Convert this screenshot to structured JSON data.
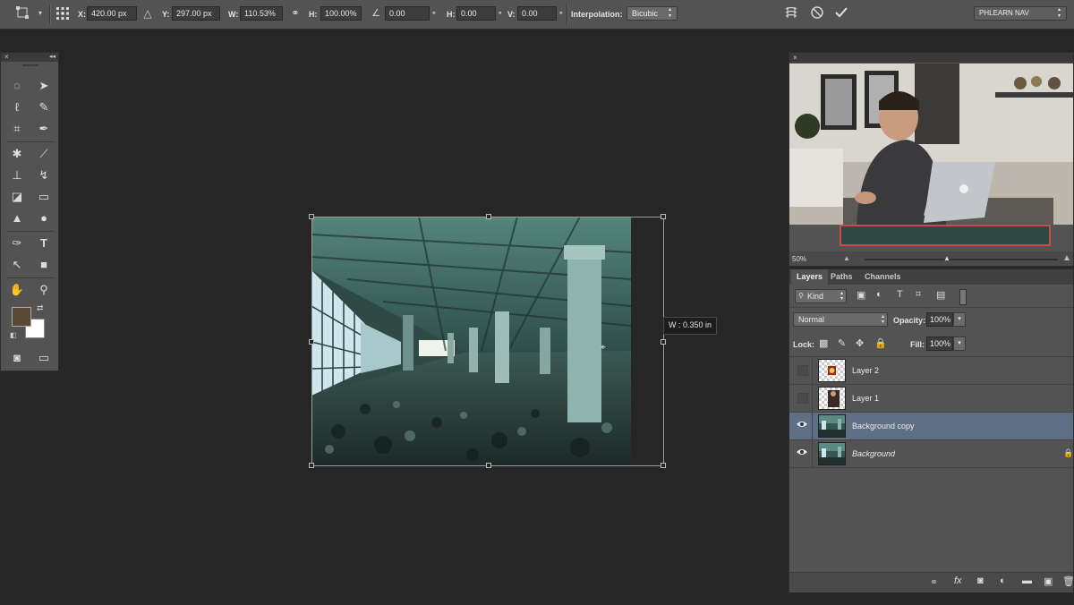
{
  "options_bar": {
    "x_label": "X:",
    "x_value": "420.00 px",
    "y_label": "Y:",
    "y_value": "297.00 px",
    "w_label": "W:",
    "w_value": "110.53%",
    "h_label": "H:",
    "h_value": "100.00%",
    "angle_value": "0.00",
    "angle_unit": "°",
    "hskew_label": "H:",
    "hskew_value": "0.00",
    "hskew_unit": "°",
    "vskew_label": "V:",
    "vskew_value": "0.00",
    "vskew_unit": "°",
    "interpolation_label": "Interpolation:",
    "interpolation_value": "Bicubic",
    "workspace_value": "PHLEARN NAV"
  },
  "canvas": {
    "tooltip": "W : 0.350 in"
  },
  "navigator": {
    "zoom": "50%"
  },
  "layers_panel": {
    "tabs": [
      "Layers",
      "Paths",
      "Channels"
    ],
    "kind_label": "Kind",
    "blend_mode": "Normal",
    "opacity_label": "Opacity:",
    "opacity_value": "100%",
    "lock_label": "Lock:",
    "fill_label": "Fill:",
    "fill_value": "100%",
    "layers": [
      {
        "name": "Layer 2",
        "visible": false,
        "selected": false
      },
      {
        "name": "Layer 1",
        "visible": false,
        "selected": false
      },
      {
        "name": "Background copy",
        "visible": true,
        "selected": true
      },
      {
        "name": "Background",
        "visible": true,
        "selected": false,
        "locked": true
      }
    ]
  },
  "colors": {
    "foreground": "#5b4a33",
    "background": "#ffffff",
    "selection": "#5f6f86"
  },
  "icons": {
    "panel_close": "×",
    "panel_collapse": "◂◂",
    "eye": "👁"
  }
}
